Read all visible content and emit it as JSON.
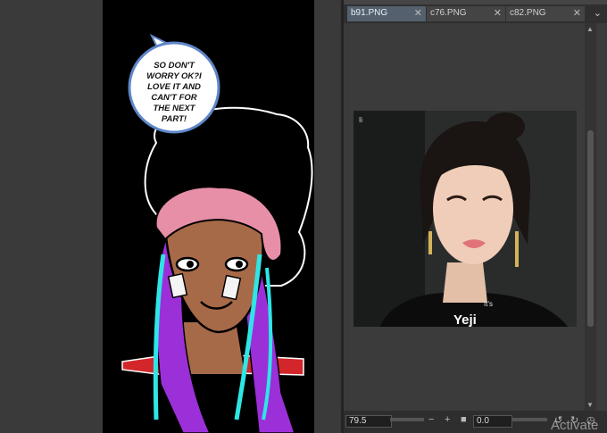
{
  "comic": {
    "speech_bubble_lines": [
      "SO DON'T",
      "WORRY OK?I",
      "LOVE IT AND",
      "CAN'T FOR",
      "THE NEXT",
      "PART!"
    ]
  },
  "tabs": [
    {
      "label": "b91.PNG",
      "active": true
    },
    {
      "label": "c76.PNG",
      "active": false
    },
    {
      "label": "c82.PNG",
      "active": false
    }
  ],
  "tab_close_glyph": "✕",
  "tab_menu_icon": "chevron-down-icon",
  "photo": {
    "corner_text": "Ii",
    "caption_small": "It's",
    "caption": "Yeji"
  },
  "bottom_bar": {
    "zoom_value": "79.5",
    "rotation_value": "0.0"
  },
  "watermark": "Activate",
  "colors": {
    "active_tab": "#54606e",
    "panel_bg": "#3b3b3b",
    "skin": "#a76a48",
    "headwrap": "#e88fa8",
    "hair_purple": "#9b30d9",
    "hair_cyan": "#2ee6e6"
  }
}
